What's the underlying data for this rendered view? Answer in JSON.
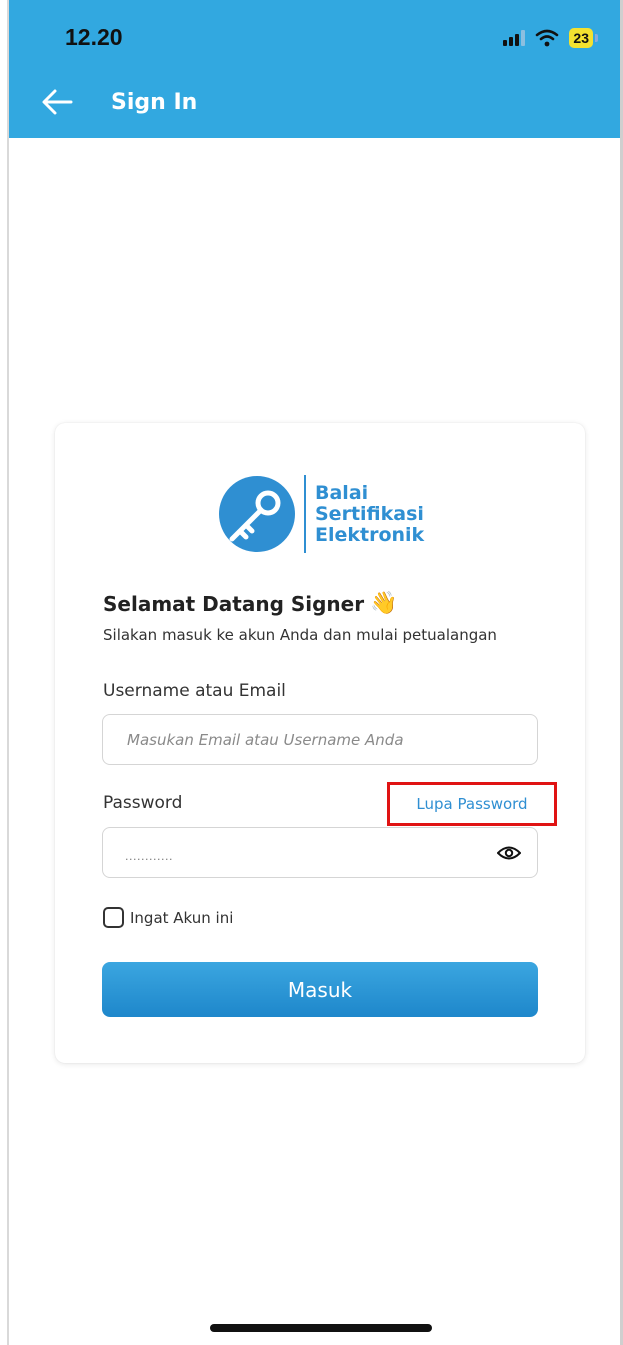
{
  "status_bar": {
    "time": "12.20",
    "battery": "23"
  },
  "header": {
    "title": "Sign In"
  },
  "logo": {
    "line1": "Balai",
    "line2": "Sertifikasi",
    "line3": "Elektronik"
  },
  "welcome": {
    "title": "Selamat Datang Signer",
    "emoji": "👋",
    "subtitle": "Silakan masuk ke akun Anda dan mulai petualangan"
  },
  "form": {
    "username_label": "Username atau Email",
    "username_placeholder": "Masukan Email atau Username Anda",
    "password_label": "Password",
    "password_mask": "............",
    "forgot_label": "Lupa Password",
    "remember_label": "Ingat Akun ini",
    "submit_label": "Masuk"
  },
  "colors": {
    "header": "#32a8e0",
    "accent": "#2f8fd2",
    "highlight": "#e01313"
  }
}
